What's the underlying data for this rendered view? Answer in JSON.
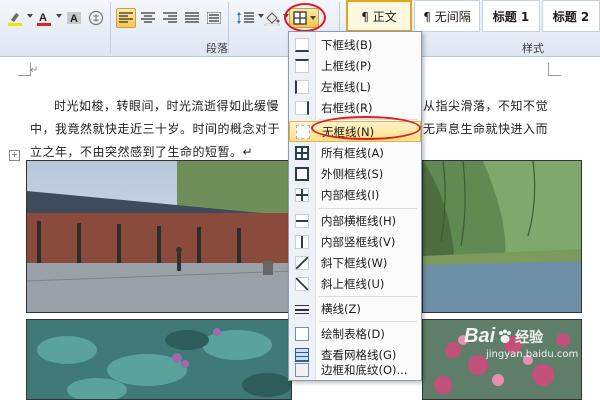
{
  "ribbon": {
    "paragraph_group_label": "段落",
    "styles_group_label": "样式",
    "styles": [
      "¶ 正文",
      "¶ 无间隔",
      "标题 1",
      "标题 2"
    ],
    "colors": {
      "highlight": "#f2e600",
      "font_color": "#e02020",
      "accent_red": "#e01b1b"
    },
    "icons": [
      "highlight-icon",
      "font-color-icon",
      "char-shading-icon",
      "char-border-icon",
      "align-left-icon",
      "align-center-icon",
      "align-right-icon",
      "justify-icon",
      "distributed-icon",
      "line-spacing-icon",
      "shading-icon",
      "borders-icon"
    ]
  },
  "document": {
    "paragraph": "时光如梭，转眼间，时光流逝得如此缓慢，从指尖滑落，不知不觉中，我竟然就快走近三十岁。时间的概念对于我来说，在无声息生命就快进入而立之年，不由突然感到了生命的短暂。",
    "para_lines": [
      "时光如梭，转眼间，时光流逝得如此缓慢",
      "从指尖滑落，不知不觉",
      "中，我竟然就快走近三十岁。时间的概念对于",
      "无声息生命就快进入而",
      "立之年，不由突然感到了生命的短暂。↵"
    ],
    "photos": [
      "corridor-photo",
      "willow-lake-photo",
      "green-plants-photo",
      "pink-blossom-photo"
    ]
  },
  "border_menu": {
    "items": [
      {
        "label": "下框线(B)",
        "icon": "bottom-border-icon"
      },
      {
        "label": "上框线(P)",
        "icon": "top-border-icon"
      },
      {
        "label": "左框线(L)",
        "icon": "left-border-icon"
      },
      {
        "label": "右框线(R)",
        "icon": "right-border-icon"
      },
      {
        "label": "无框线(N)",
        "icon": "no-border-icon",
        "highlighted": true
      },
      {
        "label": "所有框线(A)",
        "icon": "all-borders-icon"
      },
      {
        "label": "外侧框线(S)",
        "icon": "outside-borders-icon"
      },
      {
        "label": "内部框线(I)",
        "icon": "inside-borders-icon"
      },
      {
        "label": "内部横框线(H)",
        "icon": "inside-horizontal-border-icon"
      },
      {
        "label": "内部竖框线(V)",
        "icon": "inside-vertical-border-icon"
      },
      {
        "label": "斜下框线(W)",
        "icon": "diagonal-down-border-icon"
      },
      {
        "label": "斜上框线(U)",
        "icon": "diagonal-up-border-icon"
      },
      {
        "label": "横线(Z)",
        "icon": "horizontal-line-icon"
      },
      {
        "label": "绘制表格(D)",
        "icon": "draw-table-icon"
      },
      {
        "label": "查看网格线(G)",
        "icon": "view-gridlines-icon"
      },
      {
        "label": "边框和底纹(O)...",
        "icon": "borders-shading-icon"
      }
    ]
  },
  "watermark": {
    "brand": "Bai",
    "brand_cn": "经验",
    "url": "jingyan.baidu.com"
  }
}
